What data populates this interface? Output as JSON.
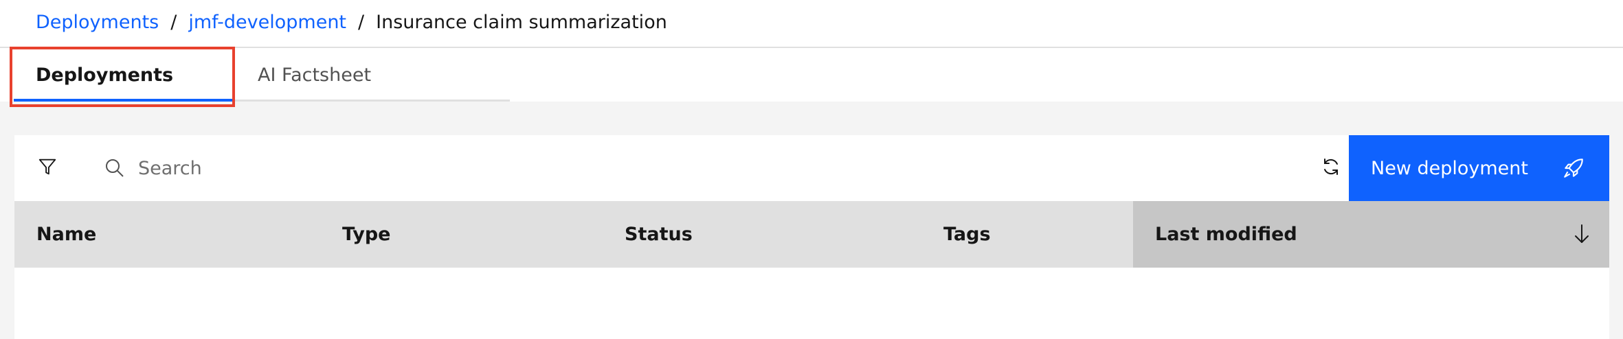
{
  "breadcrumb": {
    "items": [
      "Deployments",
      "jmf-development"
    ],
    "separator": "/",
    "current": "Insurance claim summarization"
  },
  "tabs": [
    {
      "label": "Deployments",
      "selected": true
    },
    {
      "label": "AI Factsheet",
      "selected": false
    }
  ],
  "toolbar": {
    "filter_icon": "filter-icon",
    "search_icon": "search-icon",
    "search_placeholder": "Search",
    "search_value": "",
    "refresh_icon": "refresh-icon",
    "new_button_label": "New deployment",
    "new_button_icon": "rocket-icon"
  },
  "table": {
    "columns": [
      "Name",
      "Type",
      "Status",
      "Tags",
      "Last modified"
    ],
    "sorted_column": "Last modified",
    "sort_direction": "descending",
    "rows": []
  },
  "colors": {
    "accent": "#0f62fe",
    "highlight": "#e8412e",
    "header_bg": "#e0e0e0",
    "sorted_header_bg": "#c6c6c6",
    "page_bg": "#f4f4f4"
  }
}
